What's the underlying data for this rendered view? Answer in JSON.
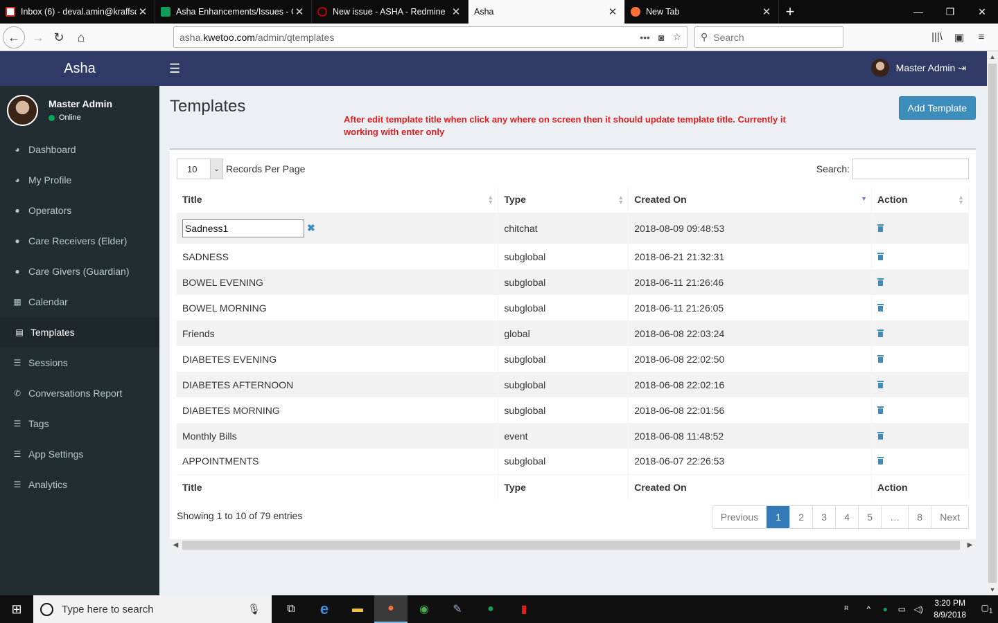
{
  "browser": {
    "tabs": [
      {
        "label": "Inbox (6) - deval.amin@kraffso",
        "color": "#d93025"
      },
      {
        "label": "Asha Enhancements/Issues - G",
        "color": "#0f9d58"
      },
      {
        "label": "New issue - ASHA - Redmine",
        "color": "#b00"
      },
      {
        "label": "Asha",
        "color": ""
      },
      {
        "label": "New Tab",
        "color": "#ff7139"
      }
    ],
    "url_prefix": "asha.",
    "url_domain": "kwetoo.com",
    "url_path": "/admin/qtemplates",
    "search_placeholder": "Search"
  },
  "app": {
    "brand": "Asha",
    "user_name": "Master Admin",
    "user_status": "Online",
    "header_user": "Master Admin"
  },
  "sidebar": {
    "items": [
      {
        "label": "Dashboard",
        "icon": "dashboard-icon"
      },
      {
        "label": "My Profile",
        "icon": "dashboard-icon"
      },
      {
        "label": "Operators",
        "icon": "user-icon"
      },
      {
        "label": "Care Receivers (Elder)",
        "icon": "user-icon"
      },
      {
        "label": "Care Givers (Guardian)",
        "icon": "user-icon"
      },
      {
        "label": "Calendar",
        "icon": "calendar-icon"
      },
      {
        "label": "Templates",
        "icon": "file-icon"
      },
      {
        "label": "Sessions",
        "icon": "list-icon"
      },
      {
        "label": "Conversations Report",
        "icon": "phone-icon"
      },
      {
        "label": "Tags",
        "icon": "list-icon"
      },
      {
        "label": "App Settings",
        "icon": "list-icon"
      },
      {
        "label": "Analytics",
        "icon": "list-icon"
      }
    ],
    "active": "Templates"
  },
  "page": {
    "title": "Templates",
    "note": "After edit template title when click any where on screen then it should update template title. Currently it working with enter only",
    "add_button": "Add Template",
    "length_value": "10",
    "length_label": "Records Per Page",
    "search_label": "Search:",
    "info": "Showing 1 to 10 of 79 entries"
  },
  "table": {
    "columns": [
      "Title",
      "Type",
      "Created On",
      "Action"
    ],
    "edit_value": "Sadness1",
    "rows": [
      {
        "title": "Sadness1",
        "type": "chitchat",
        "created": "2018-08-09 09:48:53"
      },
      {
        "title": "SADNESS",
        "type": "subglobal",
        "created": "2018-06-21 21:32:31"
      },
      {
        "title": "BOWEL EVENING",
        "type": "subglobal",
        "created": "2018-06-11 21:26:46"
      },
      {
        "title": "BOWEL MORNING",
        "type": "subglobal",
        "created": "2018-06-11 21:26:05"
      },
      {
        "title": "Friends",
        "type": "global",
        "created": "2018-06-08 22:03:24"
      },
      {
        "title": "DIABETES EVENING",
        "type": "subglobal",
        "created": "2018-06-08 22:02:50"
      },
      {
        "title": "DIABETES AFTERNOON",
        "type": "subglobal",
        "created": "2018-06-08 22:02:16"
      },
      {
        "title": "DIABETES MORNING",
        "type": "subglobal",
        "created": "2018-06-08 22:01:56"
      },
      {
        "title": "Monthly Bills",
        "type": "event",
        "created": "2018-06-08 11:48:52"
      },
      {
        "title": "APPOINTMENTS",
        "type": "subglobal",
        "created": "2018-06-07 22:26:53"
      }
    ]
  },
  "pagination": {
    "previous": "Previous",
    "pages": [
      "1",
      "2",
      "3",
      "4",
      "5",
      "…",
      "8"
    ],
    "current": "1",
    "next": "Next"
  },
  "taskbar": {
    "search_placeholder": "Type here to search",
    "time": "3:20 PM",
    "date": "8/9/2018",
    "notifications": "1"
  }
}
